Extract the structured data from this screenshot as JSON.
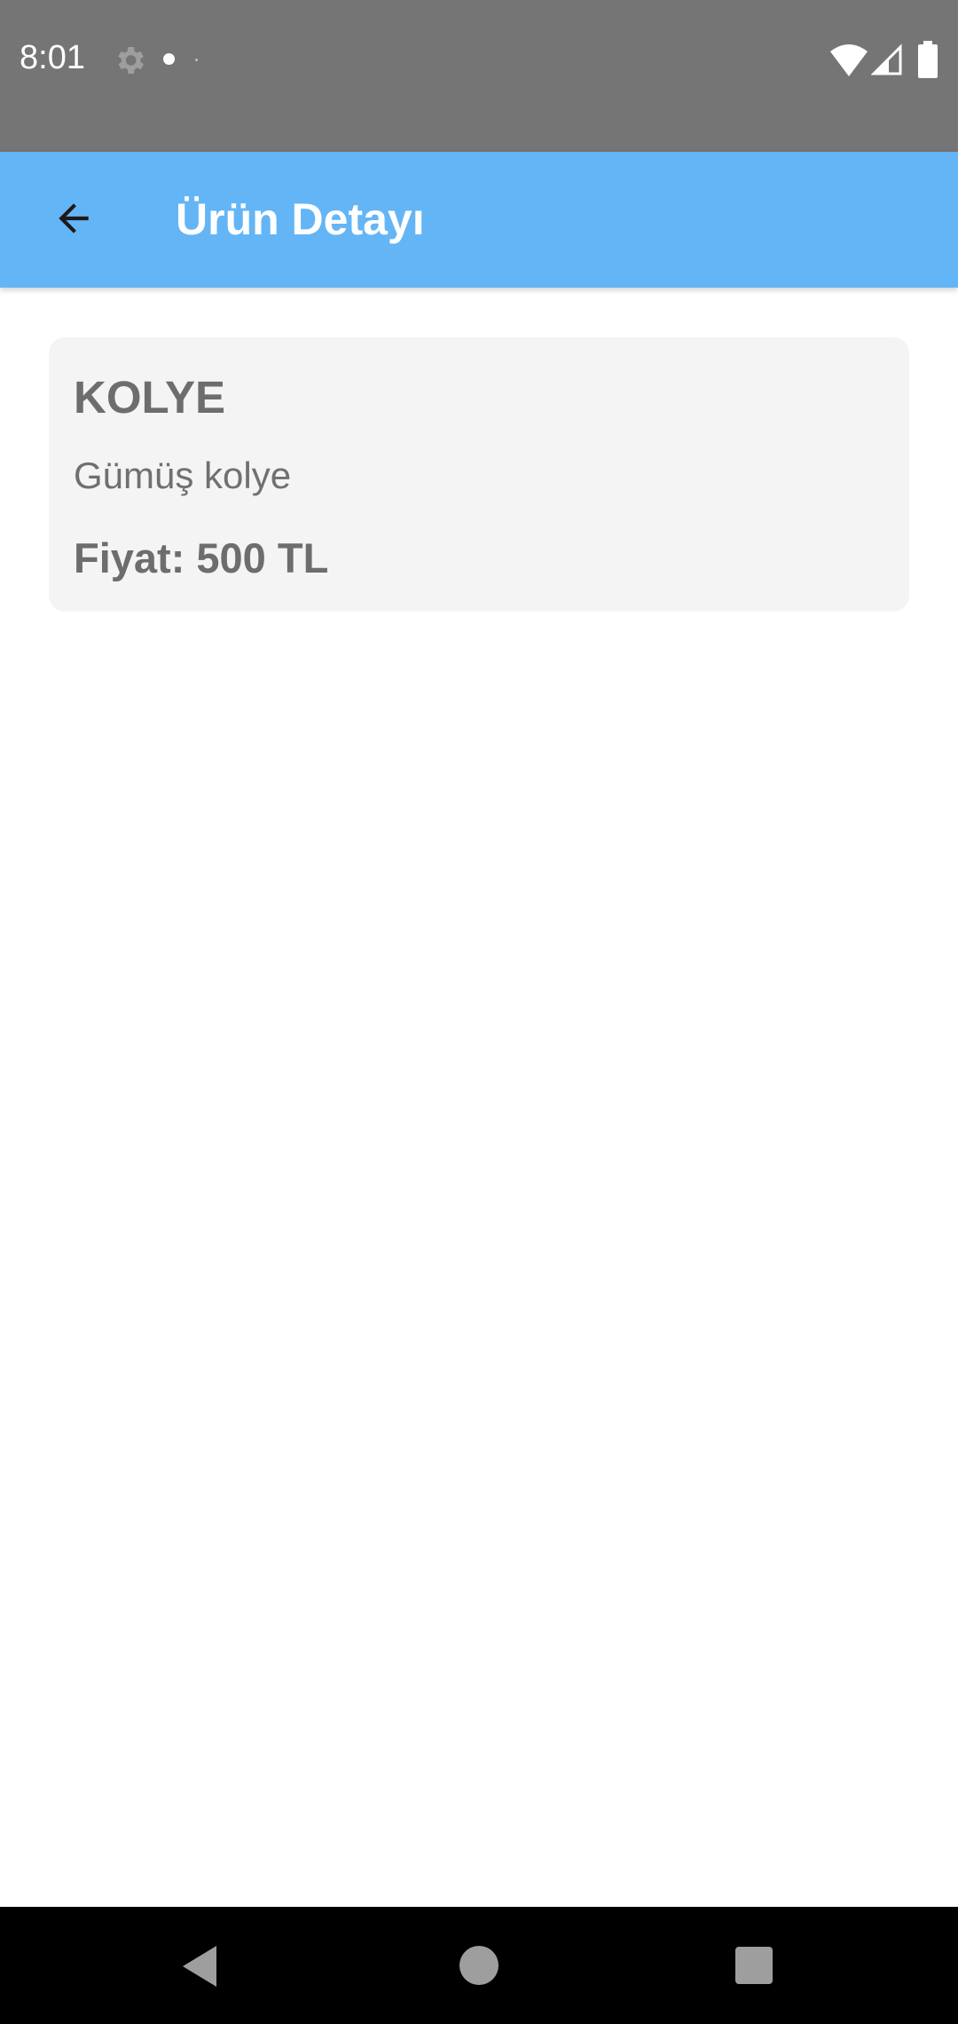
{
  "status_bar": {
    "time": "8:01",
    "icons": [
      "gear-icon",
      "notification-dot",
      "wifi-icon",
      "signal-icon",
      "battery-icon"
    ]
  },
  "app_bar": {
    "title": "Ürün Detayı",
    "back_icon": "arrow-left-icon",
    "background_color": "#64b5f6"
  },
  "product": {
    "name": "KOLYE",
    "description": "Gümüş kolye",
    "price": "Fiyat: 500 TL"
  },
  "nav_bar": {
    "icons": [
      "back-triangle-icon",
      "home-circle-icon",
      "recents-square-icon"
    ]
  },
  "colors": {
    "status_bar": "#757575",
    "card_background": "#f4f4f4",
    "text_gray": "#6d6d6d",
    "nav_bar": "#000000"
  }
}
